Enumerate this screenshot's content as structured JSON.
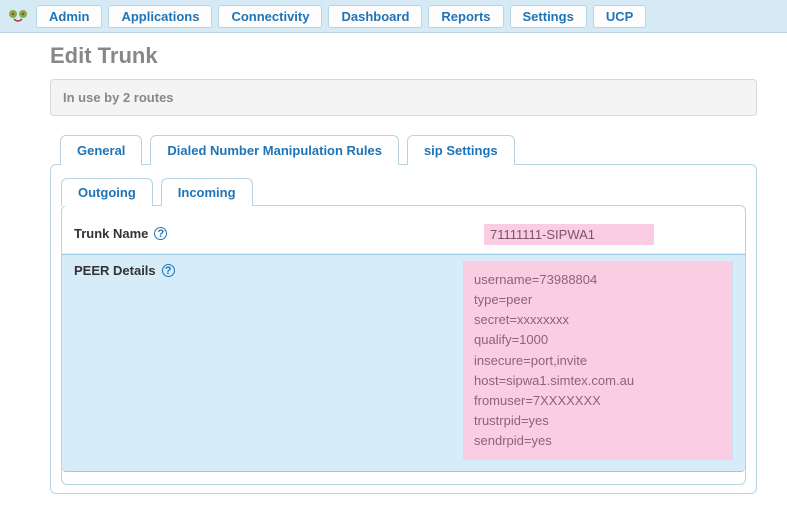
{
  "nav": {
    "items": [
      "Admin",
      "Applications",
      "Connectivity",
      "Dashboard",
      "Reports",
      "Settings",
      "UCP"
    ]
  },
  "page": {
    "title": "Edit Trunk",
    "alert": "In use by 2 routes"
  },
  "tabs": {
    "items": [
      "General",
      "Dialed Number Manipulation Rules",
      "sip Settings"
    ],
    "active": 2
  },
  "subtabs": {
    "items": [
      "Outgoing",
      "Incoming"
    ],
    "active": 0
  },
  "form": {
    "trunk_name_label": "Trunk Name",
    "trunk_name_value": "71111111-SIPWA1",
    "peer_label": "PEER Details",
    "peer_value": "username=73988804\ntype=peer\nsecret=xxxxxxxx\nqualify=1000\ninsecure=port,invite\nhost=sipwa1.simtex.com.au\nfromuser=7XXXXXXX\ntrustrpid=yes\nsendrpid=yes"
  },
  "icons": {
    "help": "?"
  }
}
